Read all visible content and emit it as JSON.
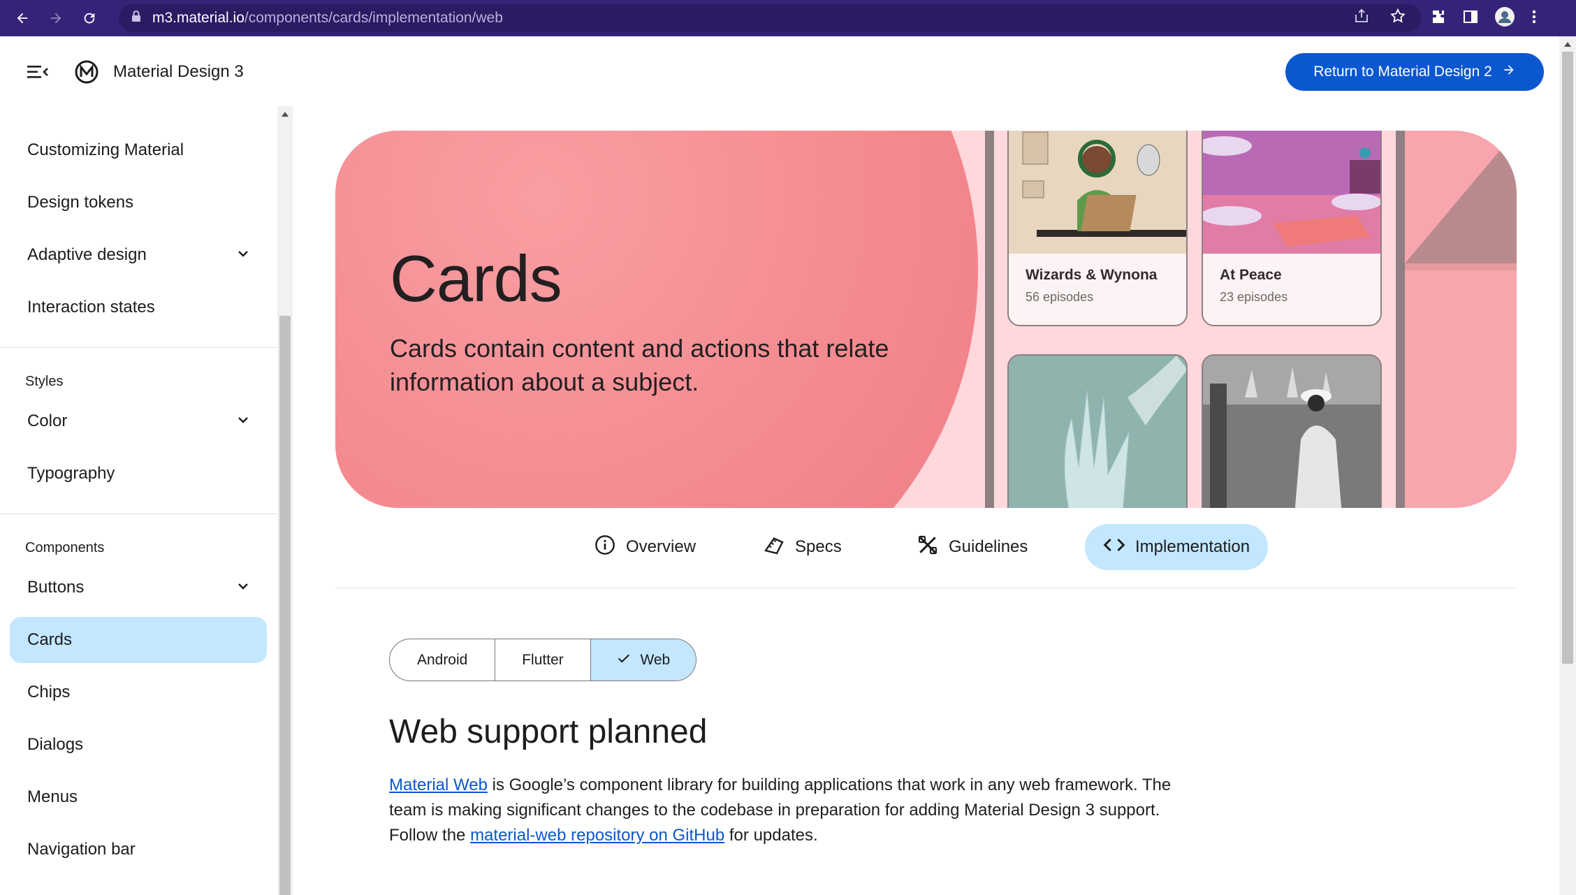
{
  "browser": {
    "url_host": "m3.material.io",
    "url_path": "/components/cards/implementation/web"
  },
  "header": {
    "site_title": "Material Design 3",
    "return_label": "Return to Material Design 2"
  },
  "sidebar": {
    "group1": [
      {
        "label": "Customizing Material"
      },
      {
        "label": "Design tokens"
      },
      {
        "label": "Adaptive design"
      },
      {
        "label": "Interaction states"
      }
    ],
    "styles_heading": "Styles",
    "styles": [
      {
        "label": "Color"
      },
      {
        "label": "Typography"
      }
    ],
    "components_heading": "Components",
    "components": [
      {
        "label": "Buttons"
      },
      {
        "label": "Cards"
      },
      {
        "label": "Chips"
      },
      {
        "label": "Dialogs"
      },
      {
        "label": "Menus"
      },
      {
        "label": "Navigation bar"
      }
    ]
  },
  "hero": {
    "title": "Cards",
    "subtitle": "Cards contain content and actions that relate information about a subject.",
    "cards": [
      {
        "name": "Wizards & Wynona",
        "episodes": "56 episodes"
      },
      {
        "name": "At Peace",
        "episodes": "23 episodes"
      }
    ]
  },
  "tabs": [
    {
      "label": "Overview"
    },
    {
      "label": "Specs"
    },
    {
      "label": "Guidelines"
    },
    {
      "label": "Implementation"
    }
  ],
  "platforms": [
    {
      "label": "Android"
    },
    {
      "label": "Flutter"
    },
    {
      "label": "Web"
    }
  ],
  "content": {
    "heading": "Web support planned",
    "link1": "Material Web",
    "text1": " is Google’s component library for building applications that work in any web framework. The team is making significant changes to the codebase in preparation for adding Material Design 3 support. Follow the ",
    "link2": "material-web repository on GitHub",
    "text2": " for updates."
  },
  "colors": {
    "browser_bar": "#35237a",
    "primary": "#0b57d0",
    "selected": "#c2e7ff",
    "hero_bg": "#ffd8dc",
    "hero_blob": "#f3888e"
  }
}
